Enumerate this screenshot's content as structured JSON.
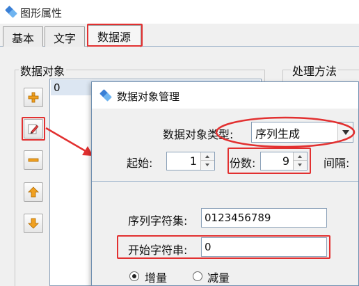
{
  "window": {
    "title": "图形属性",
    "icon": "app-diamond-icon"
  },
  "tabs": [
    {
      "label": "基本",
      "active": false
    },
    {
      "label": "文字",
      "active": false
    },
    {
      "label": "数据源",
      "active": true
    }
  ],
  "data_objects": {
    "label": "数据对象",
    "items": [
      "0"
    ],
    "buttons": [
      {
        "icon": "plus-icon"
      },
      {
        "icon": "edit-pencil-icon"
      },
      {
        "icon": "minus-icon"
      },
      {
        "icon": "arrow-up-icon"
      },
      {
        "icon": "arrow-down-icon"
      }
    ]
  },
  "processing": {
    "label": "处理方法"
  },
  "dialog": {
    "title": "数据对象管理",
    "type_label": "数据对象类型:",
    "type_value": "序列生成",
    "start_label": "起始:",
    "start_value": "1",
    "copies_label": "份数:",
    "copies_value": "9",
    "interval_label": "间隔:",
    "charset_label": "序列字符集:",
    "charset_value": "0123456789",
    "start_string_label": "开始字符串:",
    "start_string_value": "0",
    "radio_increase": "增量",
    "radio_decrease": "减量",
    "selected_radio": "增量"
  },
  "colors": {
    "highlight_box": "#e23030",
    "arrow": "#e23030",
    "button_orange": "#f0a020"
  }
}
